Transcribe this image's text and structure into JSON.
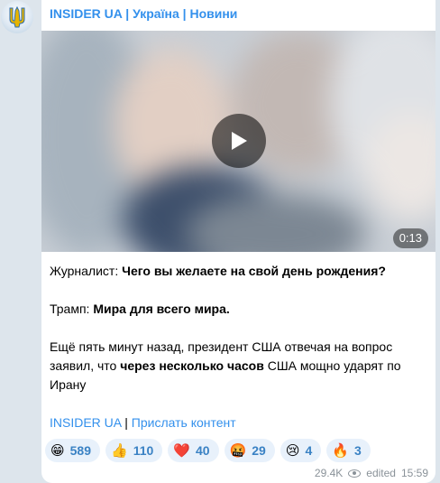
{
  "channel": {
    "name": "INSIDER UA | Україна | Новини"
  },
  "video": {
    "duration": "0:13"
  },
  "message": {
    "line1_prefix": "Журналист: ",
    "line1_bold": "Чего вы желаете на свой день рождения?",
    "line2_prefix": "Трамп: ",
    "line2_bold": "Мира для всего мира.",
    "para3_part1": "Ещё пять минут назад, президент США отвечая на вопрос заявил, что ",
    "para3_bold": "через несколько часов",
    "para3_part2": " США мощно ударят по Ирану",
    "footer_link1": "INSIDER UA",
    "footer_sep": " | ",
    "footer_link2": "Прислать контент"
  },
  "reactions": [
    {
      "emoji": "😁",
      "icon": "grinning-face-icon",
      "count": "589"
    },
    {
      "emoji": "👍",
      "icon": "thumbs-up-icon",
      "count": "110"
    },
    {
      "emoji": "❤️",
      "icon": "red-heart-icon",
      "count": "40"
    },
    {
      "emoji": "🤬",
      "icon": "angry-face-icon",
      "count": "29"
    },
    {
      "emoji": "😢",
      "icon": "crying-face-icon",
      "count": "4"
    },
    {
      "emoji": "🔥",
      "icon": "fire-icon",
      "count": "3"
    }
  ],
  "meta": {
    "views": "29.4K",
    "edited_label": "edited",
    "time": "15:59"
  },
  "colors": {
    "accent": "#3390ec",
    "background": "#dde5ec",
    "reaction_bg": "#e8f1fb"
  }
}
